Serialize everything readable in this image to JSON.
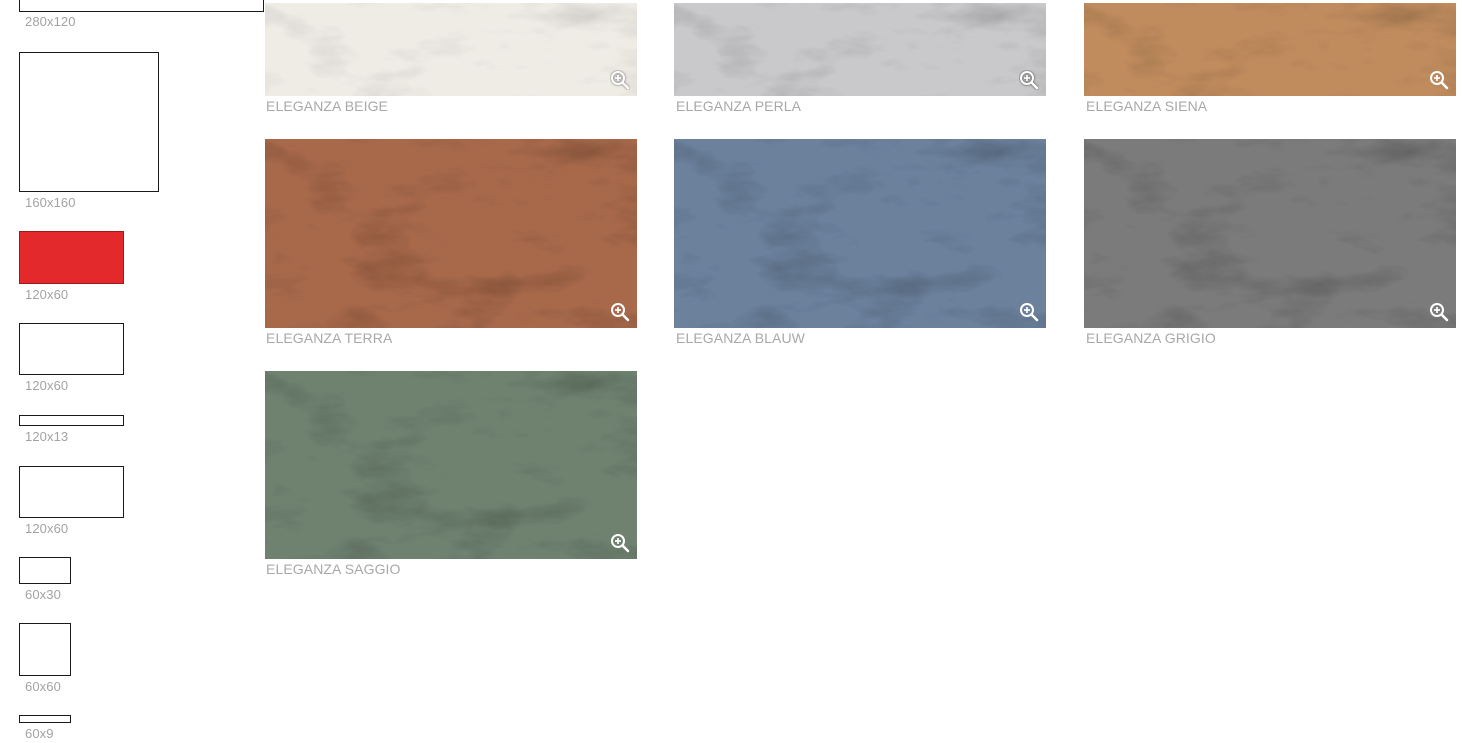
{
  "sizes": [
    {
      "label": "280x120",
      "selected": false
    },
    {
      "label": "160x160",
      "selected": false
    },
    {
      "label": "120x60",
      "selected": true,
      "color": "#e3292b"
    },
    {
      "label": "120x60",
      "selected": false
    },
    {
      "label": "120x13",
      "selected": false
    },
    {
      "label": "120x60",
      "selected": false
    },
    {
      "label": "60x30",
      "selected": false
    },
    {
      "label": "60x60",
      "selected": false
    },
    {
      "label": "60x9",
      "selected": false
    }
  ],
  "tiles": [
    {
      "name": "ELEGANZA BEIGE",
      "color": "#efece6"
    },
    {
      "name": "ELEGANZA PERLA",
      "color": "#c9c8ca"
    },
    {
      "name": "ELEGANZA SIENA",
      "color": "#c08c5e"
    },
    {
      "name": "ELEGANZA TERRA",
      "color": "#a8694b"
    },
    {
      "name": "ELEGANZA BLAUW",
      "color": "#6b819c"
    },
    {
      "name": "ELEGANZA GRIGIO",
      "color": "#7c7b7c"
    },
    {
      "name": "ELEGANZA SAGGIO",
      "color": "#6f8270"
    }
  ],
  "icons": {
    "zoom": "zoom-in-icon"
  }
}
